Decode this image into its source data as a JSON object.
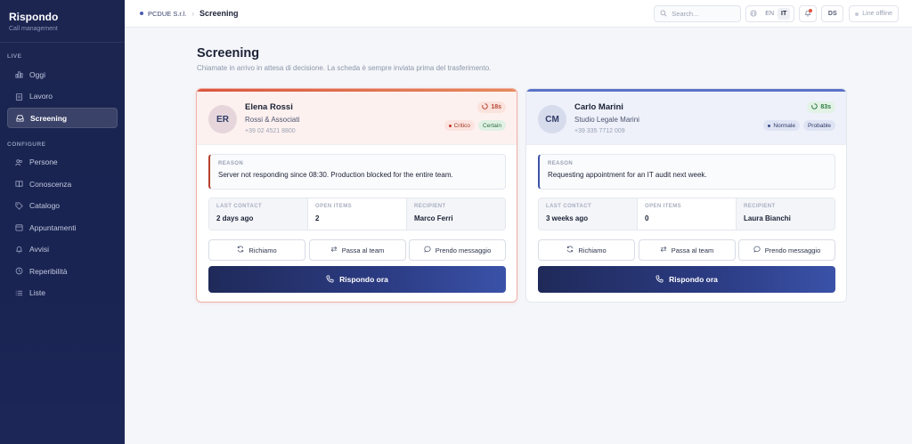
{
  "app": {
    "title": "Rispondo",
    "subtitle": "Call management"
  },
  "sidebar": {
    "sections": [
      {
        "label": "LIVE",
        "items": [
          {
            "label": "Oggi",
            "icon": "chart-bars-icon",
            "active": false
          },
          {
            "label": "Lavoro",
            "icon": "clipboard-icon",
            "active": false
          },
          {
            "label": "Screening",
            "icon": "inbox-icon",
            "active": true
          }
        ]
      },
      {
        "label": "CONFIGURE",
        "items": [
          {
            "label": "Persone",
            "icon": "people-icon",
            "active": false
          },
          {
            "label": "Conoscenza",
            "icon": "book-icon",
            "active": false
          },
          {
            "label": "Catalogo",
            "icon": "tag-icon",
            "active": false
          },
          {
            "label": "Appuntamenti",
            "icon": "calendar-icon",
            "active": false
          },
          {
            "label": "Avvisi",
            "icon": "bell-icon",
            "active": false
          },
          {
            "label": "Reperibilità",
            "icon": "clock-icon",
            "active": false
          },
          {
            "label": "Liste",
            "icon": "list-icon",
            "active": false
          }
        ]
      }
    ]
  },
  "topbar": {
    "company": "PCDUE S.r.l.",
    "separator": "›",
    "page": "Screening",
    "search_placeholder": "Search...",
    "lang_en": "EN",
    "lang_it": "IT",
    "user_initials": "DS",
    "status": "Line offline"
  },
  "main": {
    "title": "Screening",
    "subtitle": "Chiamate in arrivo in attesa di decisione. La scheda è sempre inviata prima del trasferimento."
  },
  "cards": [
    {
      "initials": "ER",
      "name": "Elena Rossi",
      "company": "Rossi & Associati",
      "phone": "+39 02 4521 8800",
      "timer": "18s",
      "priority": "Critico",
      "confidence": "Certain",
      "reason_label": "REASON",
      "reason": "Server not responding since 08:30. Production blocked for the entire team.",
      "last_contact_label": "LAST CONTACT",
      "last_contact": "2 days ago",
      "open_items_label": "OPEN ITEMS",
      "open_items": "2",
      "recipient_label": "RECIPIENT",
      "recipient": "Marco Ferri",
      "btn_callback": "Richiamo",
      "btn_transfer": "Passa al team",
      "btn_message": "Prendo messaggio",
      "btn_answer": "Rispondo ora"
    },
    {
      "initials": "CM",
      "name": "Carlo Marini",
      "company": "Studio Legale Marini",
      "phone": "+39 335 7712 009",
      "timer": "83s",
      "priority": "Normale",
      "confidence": "Probable",
      "reason_label": "REASON",
      "reason": "Requesting appointment for an IT audit next week.",
      "last_contact_label": "LAST CONTACT",
      "last_contact": "3 weeks ago",
      "open_items_label": "OPEN ITEMS",
      "open_items": "0",
      "recipient_label": "RECIPIENT",
      "recipient": "Laura Bianchi",
      "btn_callback": "Richiamo",
      "btn_transfer": "Passa al team",
      "btn_message": "Prendo messaggio",
      "btn_answer": "Rispondo ora"
    }
  ],
  "colors": {
    "sidebar_bg": "#1b2550",
    "critical_accent": "#d95840",
    "normal_accent": "#5a73c6",
    "primary_button": "#2c3c84"
  }
}
